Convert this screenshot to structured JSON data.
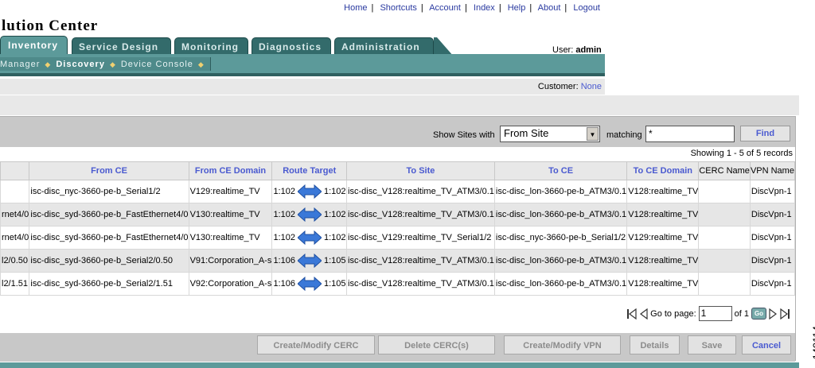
{
  "header": {
    "links": [
      "Home",
      "Shortcuts",
      "Account",
      "Index",
      "Help",
      "About",
      "Logout"
    ],
    "app_title": "lution Center",
    "user_label": "User:",
    "user_name": "admin"
  },
  "tabs": [
    {
      "label": "Inventory",
      "active": true
    },
    {
      "label": "Service Design",
      "active": false
    },
    {
      "label": "Monitoring",
      "active": false
    },
    {
      "label": "Diagnostics",
      "active": false
    },
    {
      "label": "Administration",
      "active": false
    }
  ],
  "subnav": {
    "items": [
      "Manager",
      "Discovery",
      "Device Console"
    ],
    "current": "Discovery"
  },
  "customer": {
    "label": "Customer:",
    "value": "None"
  },
  "filter": {
    "show_sites_label": "Show Sites with",
    "select_value": "From Site",
    "matching_label": "matching",
    "match_value": "*",
    "find_label": "Find"
  },
  "showing_text": "Showing 1 - 5 of 5 records",
  "table": {
    "columns": [
      "",
      "From CE",
      "From CE Domain",
      "Route Target",
      "To Site",
      "To CE",
      "To CE Domain",
      "CERC Name",
      "VPN Name"
    ],
    "rows": [
      {
        "c0": "",
        "from_ce": "isc-disc_nyc-3660-pe-b_Serial1/2",
        "from_ce_domain": "V129:realtime_TV",
        "rt_from": "1:102",
        "rt_to": "1:102",
        "to_site": "isc-disc_V128:realtime_TV_ATM3/0.1",
        "to_ce": "isc-disc_lon-3660-pe-b_ATM3/0.1",
        "to_ce_domain": "V128:realtime_TV",
        "cerc": "",
        "vpn": "DiscVpn-1"
      },
      {
        "c0": "rnet4/0",
        "from_ce": "isc-disc_syd-3660-pe-b_FastEthernet4/0",
        "from_ce_domain": "V130:realtime_TV",
        "rt_from": "1:102",
        "rt_to": "1:102",
        "to_site": "isc-disc_V128:realtime_TV_ATM3/0.1",
        "to_ce": "isc-disc_lon-3660-pe-b_ATM3/0.1",
        "to_ce_domain": "V128:realtime_TV",
        "cerc": "",
        "vpn": "DiscVpn-1"
      },
      {
        "c0": "rnet4/0",
        "from_ce": "isc-disc_syd-3660-pe-b_FastEthernet4/0",
        "from_ce_domain": "V130:realtime_TV",
        "rt_from": "1:102",
        "rt_to": "1:102",
        "to_site": "isc-disc_V129:realtime_TV_Serial1/2",
        "to_ce": "isc-disc_nyc-3660-pe-b_Serial1/2",
        "to_ce_domain": "V129:realtime_TV",
        "cerc": "",
        "vpn": "DiscVpn-1"
      },
      {
        "c0": "l2/0.50",
        "from_ce": "isc-disc_syd-3660-pe-b_Serial2/0.50",
        "from_ce_domain": "V91:Corporation_A-s",
        "rt_from": "1:106",
        "rt_to": "1:105",
        "to_site": "isc-disc_V128:realtime_TV_ATM3/0.1",
        "to_ce": "isc-disc_lon-3660-pe-b_ATM3/0.1",
        "to_ce_domain": "V128:realtime_TV",
        "cerc": "",
        "vpn": "DiscVpn-1"
      },
      {
        "c0": "l2/1.51",
        "from_ce": "isc-disc_syd-3660-pe-b_Serial2/1.51",
        "from_ce_domain": "V92:Corporation_A-s",
        "rt_from": "1:106",
        "rt_to": "1:105",
        "to_site": "isc-disc_V128:realtime_TV_ATM3/0.1",
        "to_ce": "isc-disc_lon-3660-pe-b_ATM3/0.1",
        "to_ce_domain": "V128:realtime_TV",
        "cerc": "",
        "vpn": "DiscVpn-1"
      }
    ]
  },
  "pager": {
    "goto_label": "Go to page:",
    "page_value": "1",
    "of_label": "of 1",
    "go_label": "Go"
  },
  "buttons": [
    {
      "label": "Create/Modify CERC",
      "enabled": false
    },
    {
      "label": "Delete CERC(s)",
      "enabled": false
    },
    {
      "label": "Create/Modify VPN",
      "enabled": false
    },
    {
      "label": "Details",
      "enabled": false
    },
    {
      "label": "Save",
      "enabled": false
    },
    {
      "label": "Cancel",
      "enabled": true
    }
  ],
  "figure_id": "149114",
  "colors": {
    "teal": "#5c9a9a",
    "link": "#4a5ad0",
    "arrow": "#3a78d8"
  }
}
